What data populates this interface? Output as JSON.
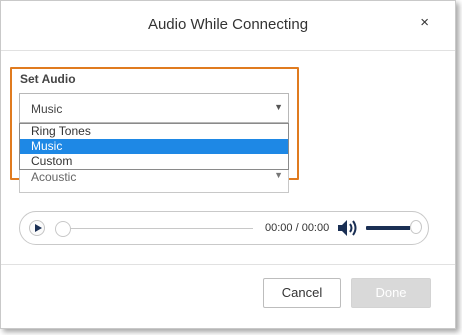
{
  "dialog": {
    "title": "Audio While Connecting",
    "close_label": "×"
  },
  "set_audio": {
    "label": "Set Audio",
    "selected_value": "Music",
    "options": [
      "Ring Tones",
      "Music",
      "Custom"
    ],
    "selected_index": 1,
    "secondary_value": "Acoustic"
  },
  "player": {
    "time": "00:00 / 00:00",
    "progress": 0,
    "volume": 0.9
  },
  "footer": {
    "cancel_label": "Cancel",
    "done_label": "Done"
  },
  "colors": {
    "highlight": "#e07b1f",
    "selected_option": "#1e88e5",
    "player_accent": "#1a2f54"
  }
}
